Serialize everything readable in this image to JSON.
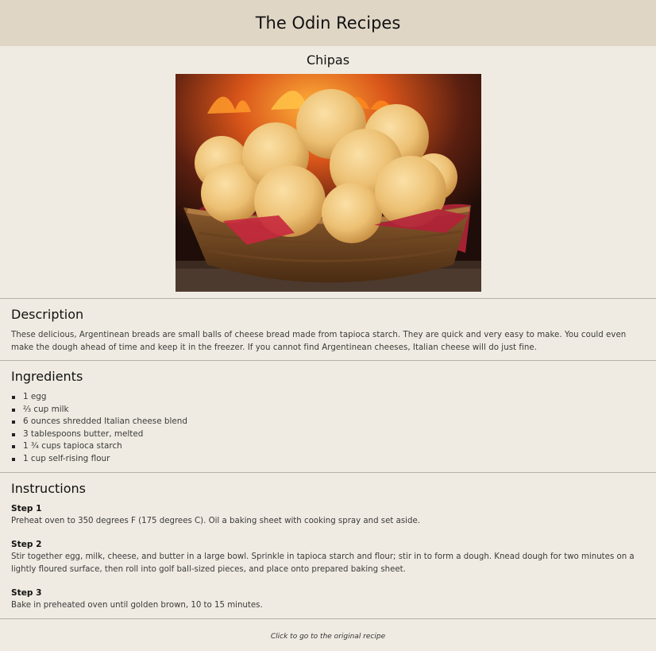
{
  "header": {
    "title": "The Odin Recipes"
  },
  "recipe": {
    "title": "Chipas",
    "image_alt": "Basket of chipas cheese bread in front of a fire"
  },
  "description": {
    "heading": "Description",
    "text": "These delicious, Argentinean breads are small balls of cheese bread made from tapioca starch. They are quick and very easy to make. You could even make the dough ahead of time and keep it in the freezer. If you cannot find Argentinean cheeses, Italian cheese will do just fine."
  },
  "ingredients": {
    "heading": "Ingredients",
    "items": [
      "1 egg",
      "⅔ cup milk",
      "6 ounces shredded Italian cheese blend",
      "3 tablespoons butter, melted",
      "1 ¾ cups tapioca starch",
      "1 cup self-rising flour"
    ]
  },
  "instructions": {
    "heading": "Instructions",
    "steps": [
      {
        "title": "Step 1",
        "text": "Preheat oven to 350 degrees F (175 degrees C). Oil a baking sheet with cooking spray and set aside."
      },
      {
        "title": "Step 2",
        "text": "Stir together egg, milk, cheese, and butter in a large bowl. Sprinkle in tapioca starch and flour; stir in to form a dough. Knead dough for two minutes on a lightly floured surface, then roll into golf ball-sized pieces, and place onto prepared baking sheet."
      },
      {
        "title": "Step 3",
        "text": "Bake in preheated oven until golden brown, 10 to 15 minutes."
      }
    ]
  },
  "footer": {
    "link_text": "Click to go to the original recipe"
  },
  "colors": {
    "background": "#f0ebe2",
    "header": "#e0d6c6",
    "divider": "#b7b0a6"
  }
}
